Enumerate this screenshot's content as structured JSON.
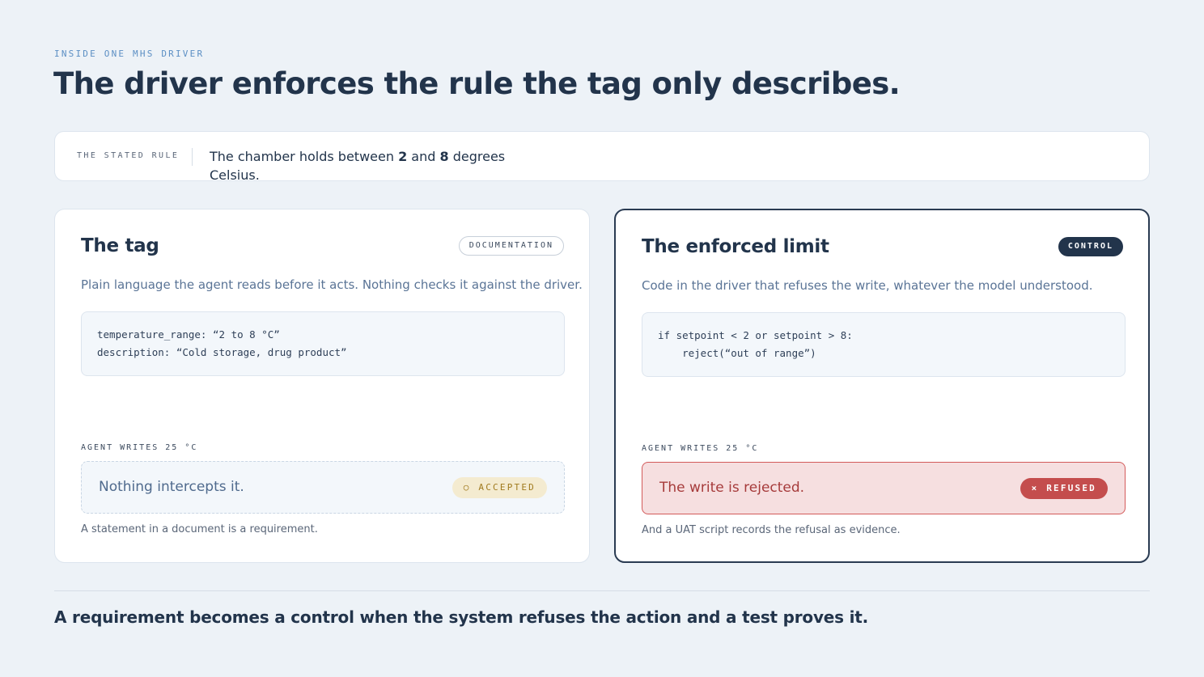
{
  "eyebrow": "INSIDE ONE MHS DRIVER",
  "title": "The driver enforces the rule the tag only describes.",
  "stated_rule": {
    "label": "THE STATED RULE",
    "text_before": "The chamber holds between ",
    "low": "2",
    "text_middle": " and ",
    "high": "8",
    "text_after": " degrees Celsius."
  },
  "left_card": {
    "title": "The tag",
    "pill": "DOCUMENTATION",
    "description": "Plain language the agent reads before it acts. Nothing checks it against the driver.",
    "code_lines": [
      "temperature_range: “2 to 8 °C”",
      "description: “Cold storage, drug product”"
    ],
    "writes_label": "AGENT WRITES 25 °C",
    "result_text": "Nothing intercepts it.",
    "badge_icon": "○",
    "badge_label": "ACCEPTED",
    "footnote": "A statement in a document is a requirement."
  },
  "right_card": {
    "title": "The enforced limit",
    "pill": "CONTROL",
    "description": "Code in the driver that refuses the write, whatever the model understood.",
    "code_lines": [
      "if setpoint < 2 or setpoint > 8:",
      "    reject(“out of range”)"
    ],
    "writes_label": "AGENT WRITES 25 °C",
    "result_text": "The write is rejected.",
    "badge_icon": "×",
    "badge_label": "REFUSED",
    "footnote": "And a UAT script records the refusal as evidence."
  },
  "conclusion": "A requirement becomes a control when the system refuses the action and a test proves it."
}
